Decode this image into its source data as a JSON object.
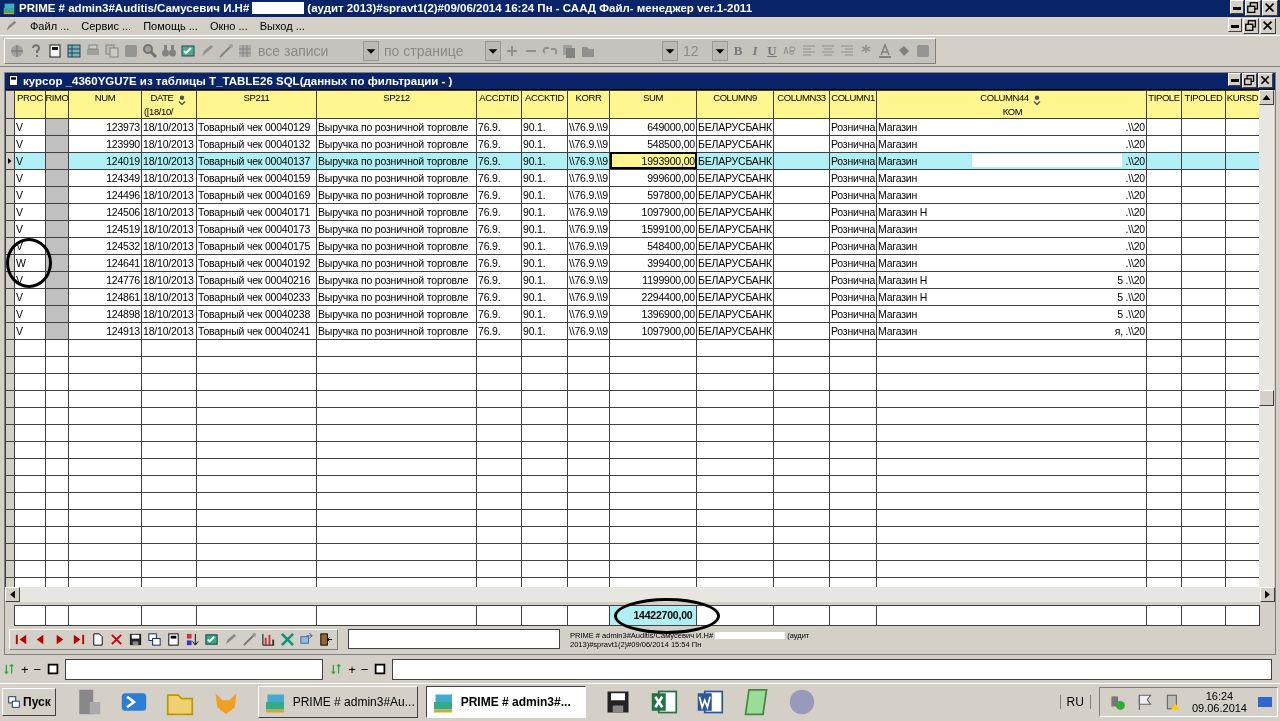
{
  "window": {
    "title_start": "PRIME # admin3#Auditis/Самусевич И.Н#",
    "redacted": true,
    "title_end": "(аудит 2013)#spravt1(2)#09/06/2014 16:24 Пн - СААД Файл- менеджер ver.1-2011"
  },
  "menu": [
    {
      "label": "Файл ..."
    },
    {
      "label": "Сервис ..."
    },
    {
      "label": "Помощь ..."
    },
    {
      "label": "Окно ..."
    },
    {
      "label": "Выход ..."
    }
  ],
  "toolbar": {
    "record_filter": "все записи",
    "paging": "по странице",
    "font_size": "12",
    "bold": "B",
    "italic": "I",
    "underline": "U"
  },
  "cursor_window": {
    "title": "курсор _4360YGU7E из таблицы T_TABLE26 SQL(данных по фильтрации -  )"
  },
  "table": {
    "columns": [
      {
        "label": "PROC"
      },
      {
        "label": "RIMO"
      },
      {
        "label": "NUM"
      },
      {
        "label": "DATE",
        "sub": "([18/10/",
        "sort_icon": true
      },
      {
        "label": "SP211"
      },
      {
        "label": "SP212"
      },
      {
        "label": "ACCDTID"
      },
      {
        "label": "ACCKTID"
      },
      {
        "label": "KORR"
      },
      {
        "label": "SUM"
      },
      {
        "label": "COLUMN9"
      },
      {
        "label": "COLUMN33"
      },
      {
        "label": "COLUMN1"
      },
      {
        "label": "COLUMN44",
        "sub": "КОМ",
        "sort_icon": true
      },
      {
        "label": "TIPOLE"
      },
      {
        "label": "TIPOLED"
      },
      {
        "label": "KURSD"
      }
    ],
    "rows": [
      {
        "selected": false,
        "circled": false,
        "proc": "V",
        "num": "123973",
        "date": "18/10/2013",
        "sp211": "Товарный чек 00040129",
        "sp212": "Выручка по розничной торговле",
        "accdtid": "76.9.",
        "accktid": "90.1.",
        "korr": "\\\\76.9.\\\\9",
        "sum": "649000,00",
        "column9": "БЕЛАРУСБАНК",
        "column10": "Рознична",
        "column44": "Магазин",
        "column44_end": ".\\\\20"
      },
      {
        "selected": false,
        "circled": false,
        "proc": "V",
        "num": "123990",
        "date": "18/10/2013",
        "sp211": "Товарный чек 00040132",
        "sp212": "Выручка по розничной торговле",
        "accdtid": "76.9.",
        "accktid": "90.1.",
        "korr": "\\\\76.9.\\\\9",
        "sum": "548500,00",
        "column9": "БЕЛАРУСБАНК",
        "column10": "Рознична",
        "column44": "Магазин",
        "column44_end": ".\\\\20"
      },
      {
        "selected": true,
        "circled": false,
        "proc": "V",
        "num": "124019",
        "date": "18/10/2013",
        "sp211": "Товарный чек 00040137",
        "sp212": "Выручка по розничной торговле",
        "accdtid": "76.9.",
        "accktid": "90.1.",
        "korr": "\\\\76.9.\\\\9",
        "sum": "1993900,00",
        "column9": "БЕЛАРУСБАНК",
        "column10": "Рознична",
        "column44": "Магазин",
        "column44_end": ".\\\\20"
      },
      {
        "selected": false,
        "circled": false,
        "proc": "V",
        "num": "124349",
        "date": "18/10/2013",
        "sp211": "Товарный чек 00040159",
        "sp212": "Выручка по розничной торговле",
        "accdtid": "76.9.",
        "accktid": "90.1.",
        "korr": "\\\\76.9.\\\\9",
        "sum": "999600,00",
        "column9": "БЕЛАРУСБАНК",
        "column10": "Рознична",
        "column44": "Магазин",
        "column44_end": ".\\\\20"
      },
      {
        "selected": false,
        "circled": false,
        "proc": "V",
        "num": "124496",
        "date": "18/10/2013",
        "sp211": "Товарный чек 00040169",
        "sp212": "Выручка по розничной торговле",
        "accdtid": "76.9.",
        "accktid": "90.1.",
        "korr": "\\\\76.9.\\\\9",
        "sum": "597800,00",
        "column9": "БЕЛАРУСБАНК",
        "column10": "Рознична",
        "column44": "Магазин",
        "column44_end": ".\\\\20"
      },
      {
        "selected": false,
        "circled": false,
        "proc": "V",
        "num": "124506",
        "date": "18/10/2013",
        "sp211": "Товарный чек 00040171",
        "sp212": "Выручка по розничной торговле",
        "accdtid": "76.9.",
        "accktid": "90.1.",
        "korr": "\\\\76.9.\\\\9",
        "sum": "1097900,00",
        "column9": "БЕЛАРУСБАНК",
        "column10": "Рознична",
        "column44": "Магазин Н",
        "column44_end": ".\\\\20"
      },
      {
        "selected": false,
        "circled": false,
        "proc": "V",
        "num": "124519",
        "date": "18/10/2013",
        "sp211": "Товарный чек 00040173",
        "sp212": "Выручка по розничной торговле",
        "accdtid": "76.9.",
        "accktid": "90.1.",
        "korr": "\\\\76.9.\\\\9",
        "sum": "1599100,00",
        "column9": "БЕЛАРУСБАНК",
        "column10": "Рознична",
        "column44": "Магазин",
        "column44_end": ".\\\\20"
      },
      {
        "selected": false,
        "circled": false,
        "proc": "V",
        "num": "124532",
        "date": "18/10/2013",
        "sp211": "Товарный чек 00040175",
        "sp212": "Выручка по розничной торговле",
        "accdtid": "76.9.",
        "accktid": "90.1.",
        "korr": "\\\\76.9.\\\\9",
        "sum": "548400,00",
        "column9": "БЕЛАРУСБАНК",
        "column10": "Рознична",
        "column44": "Магазин",
        "column44_end": ".\\\\20"
      },
      {
        "selected": false,
        "circled": true,
        "proc": "W",
        "num": "124641",
        "date": "18/10/2013",
        "sp211": "Товарный чек 00040192",
        "sp212": "Выручка по розничной торговле",
        "accdtid": "76.9.",
        "accktid": "90.1.",
        "korr": "\\\\76.9.\\\\9",
        "sum": "399400,00",
        "column9": "БЕЛАРУСБАНК",
        "column10": "Рознична",
        "column44": "Магазин",
        "column44_end": ".\\\\20"
      },
      {
        "selected": false,
        "circled": false,
        "proc": "V",
        "num": "124776",
        "date": "18/10/2013",
        "sp211": "Товарный чек 00040216",
        "sp212": "Выручка по розничной торговле",
        "accdtid": "76.9.",
        "accktid": "90.1.",
        "korr": "\\\\76.9.\\\\9",
        "sum": "1199900,00",
        "column9": "БЕЛАРУСБАНК",
        "column10": "Рознична",
        "column44": "Магазин Н",
        "column44_end": "5 .\\\\20"
      },
      {
        "selected": false,
        "circled": false,
        "proc": "V",
        "num": "124861",
        "date": "18/10/2013",
        "sp211": "Товарный чек 00040233",
        "sp212": "Выручка по розничной торговле",
        "accdtid": "76.9.",
        "accktid": "90.1.",
        "korr": "\\\\76.9.\\\\9",
        "sum": "2294400,00",
        "column9": "БЕЛАРУСБАНК",
        "column10": "Рознична",
        "column44": "Магазин Н",
        "column44_end": "5 .\\\\20"
      },
      {
        "selected": false,
        "circled": false,
        "proc": "V",
        "num": "124898",
        "date": "18/10/2013",
        "sp211": "Товарный чек 00040238",
        "sp212": "Выручка по розничной торговле",
        "accdtid": "76.9.",
        "accktid": "90.1.",
        "korr": "\\\\76.9.\\\\9",
        "sum": "1396900,00",
        "column9": "БЕЛАРУСБАНК",
        "column10": "Рознична",
        "column44": "Магазин",
        "column44_end": "5 .\\\\20"
      },
      {
        "selected": false,
        "circled": false,
        "proc": "V",
        "num": "124913",
        "date": "18/10/2013",
        "sp211": "Товарный чек 00040241",
        "sp212": "Выручка по розничной торговле",
        "accdtid": "76.9.",
        "accktid": "90.1.",
        "korr": "\\\\76.9.\\\\9",
        "sum": "1097900,00",
        "column9": "БЕЛАРУСБАНК",
        "column10": "Рознична",
        "column44": "Магазин",
        "column44_end": "я, .\\\\20"
      }
    ],
    "totals": {
      "sum": "14422700,00",
      "circled": true
    }
  },
  "status": {
    "line_1": "PRIME # admin3#Auditis/Самусевич И.Н#",
    "line_2": "2013)#spravt1(2)#09/06/2014 15:54 Пн",
    "line_1_end": "(аудит"
  },
  "filter_bars": [
    {
      "plus": "+",
      "minus": "−"
    },
    {
      "plus": "+",
      "minus": "−"
    }
  ],
  "taskbar": {
    "start": "Пуск",
    "tasks": [
      {
        "label": "PRIME # admin3#Au...",
        "selected": false
      },
      {
        "label": "PRIME # admin3#...",
        "selected": true
      }
    ],
    "language": "RU",
    "time": "16:24",
    "date": "09.06.2014"
  }
}
